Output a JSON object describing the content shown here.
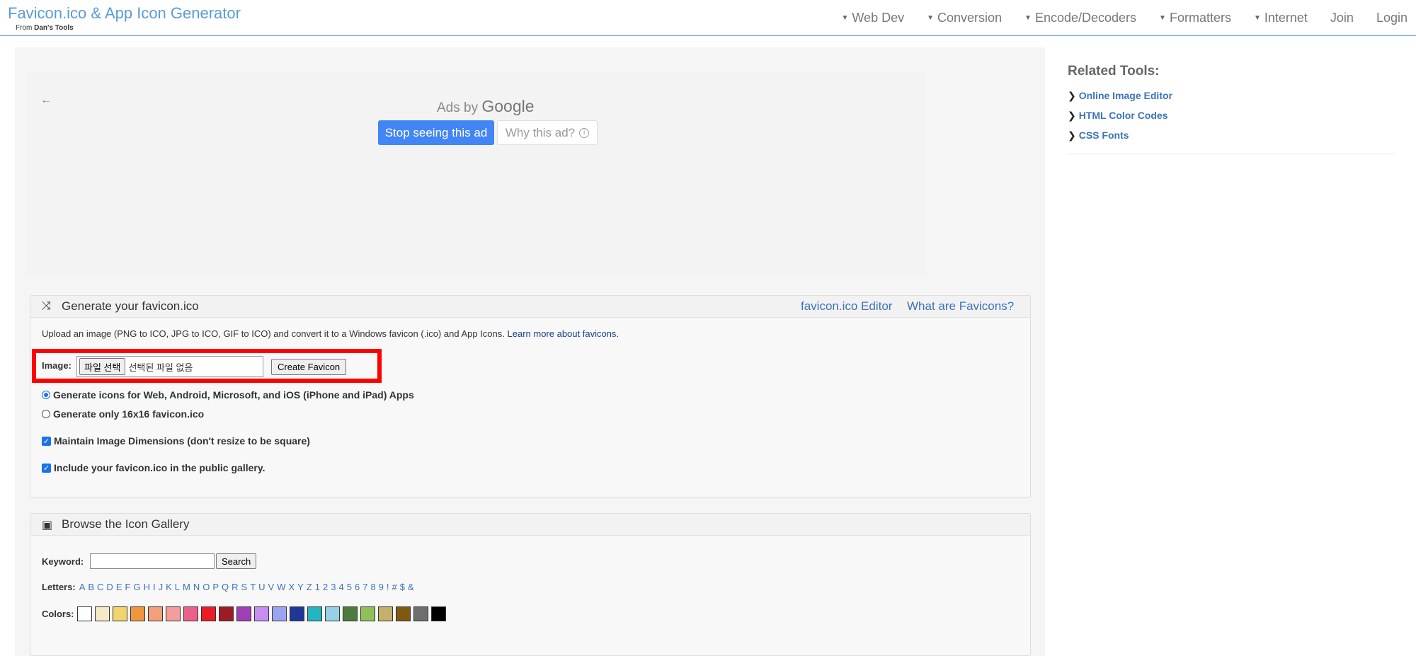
{
  "header": {
    "brand": "Favicon.ico & App Icon Generator",
    "brand_from": "From",
    "brand_sub": "Dan's Tools"
  },
  "nav": [
    {
      "label": "Web Dev",
      "dropdown": true
    },
    {
      "label": "Conversion",
      "dropdown": true
    },
    {
      "label": "Encode/Decoders",
      "dropdown": true
    },
    {
      "label": "Formatters",
      "dropdown": true
    },
    {
      "label": "Internet",
      "dropdown": true
    },
    {
      "label": "Join",
      "dropdown": false
    },
    {
      "label": "Login",
      "dropdown": false
    }
  ],
  "ad": {
    "ads_by": "Ads by",
    "google": "Google",
    "stop": "Stop seeing this ad",
    "why": "Why this ad?",
    "back_icon": "back-arrow-icon"
  },
  "generate": {
    "icon": "shuffle-icon",
    "title": "Generate your favicon.ico",
    "link_editor": "favicon.ico Editor",
    "link_what": "What are Favicons?",
    "description": "Upload an image (PNG to ICO, JPG to ICO, GIF to ICO) and convert it to a Windows favicon (.ico) and App Icons. ",
    "learn_more": "Learn more about favicons",
    "image_label": "Image:",
    "file_button": "파일 선택",
    "file_status": "선택된 파일 없음",
    "create_button": "Create Favicon",
    "option_all": "Generate icons for Web, Android, Microsoft, and iOS (iPhone and iPad) Apps",
    "option_16": "Generate only 16x16 favicon.ico",
    "option_maintain": "Maintain Image Dimensions (don't resize to be square)",
    "option_gallery": "Include your favicon.ico in the public gallery."
  },
  "gallery": {
    "icon": "image-icon",
    "title": "Browse the Icon Gallery",
    "keyword_label": "Keyword:",
    "search_button": "Search",
    "letters_label": "Letters:",
    "letters": [
      "A",
      "B",
      "C",
      "D",
      "E",
      "F",
      "G",
      "H",
      "I",
      "J",
      "K",
      "L",
      "M",
      "N",
      "O",
      "P",
      "Q",
      "R",
      "S",
      "T",
      "U",
      "V",
      "W",
      "X",
      "Y",
      "Z",
      "1",
      "2",
      "3",
      "4",
      "5",
      "6",
      "7",
      "8",
      "9",
      "!",
      "#",
      "$",
      "&"
    ],
    "colors_label": "Colors:",
    "colors": [
      "#ffffff",
      "#f5e9c8",
      "#f3d36b",
      "#f0963c",
      "#f2a07a",
      "#f59c9c",
      "#ec5f8a",
      "#ec1c24",
      "#9e1b26",
      "#9e3fb5",
      "#c58ef0",
      "#9aa5f0",
      "#1f3898",
      "#23b5c0",
      "#98d0e8",
      "#4b7c3d",
      "#8fc05a",
      "#c4b06a",
      "#7d5a10",
      "#6e6e6e",
      "#000000"
    ]
  },
  "sidebar": {
    "title": "Related Tools:",
    "items": [
      "Online Image Editor",
      "HTML Color Codes",
      "CSS Fonts"
    ]
  }
}
